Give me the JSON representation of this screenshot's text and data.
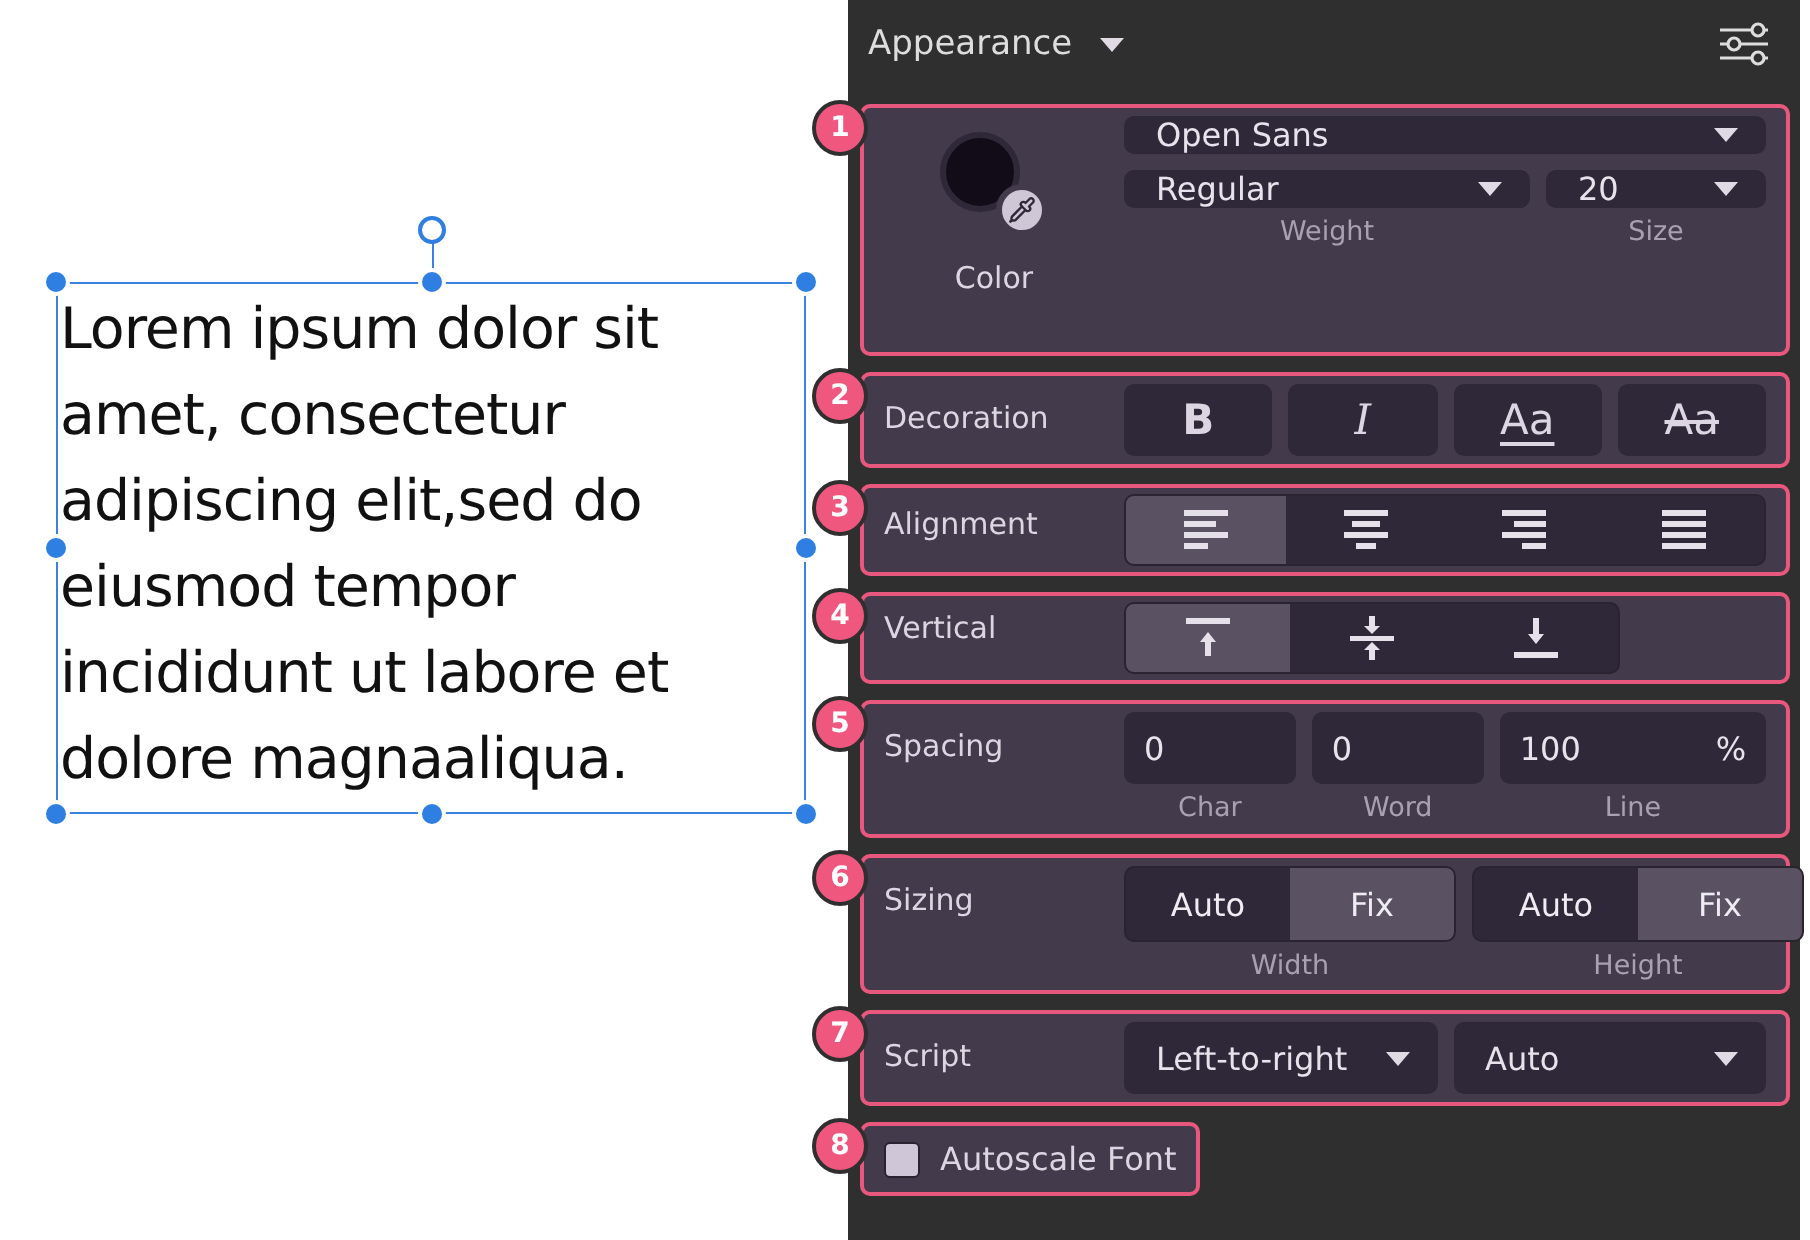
{
  "canvas": {
    "text_lines": [
      "Lorem ipsum dolor sit",
      "amet, consectetur",
      "adipiscing elit,sed do",
      "eiusmod tempor",
      "incididunt ut labore et",
      "dolore magnaaliqua."
    ]
  },
  "panel": {
    "title": "Appearance"
  },
  "sections": [
    {
      "kind": "font",
      "badge": "1",
      "color_label": "Color",
      "font": "Open Sans",
      "weight": "Regular",
      "size": "20",
      "weight_caption": "Weight",
      "size_caption": "Size"
    },
    {
      "kind": "decoration",
      "badge": "2",
      "label": "Decoration",
      "buttons": [
        {
          "kind": "bold",
          "text": "B"
        },
        {
          "kind": "italic",
          "text": "I"
        },
        {
          "kind": "underline",
          "text": "Aa"
        },
        {
          "kind": "strike",
          "text": "Aa"
        }
      ]
    },
    {
      "kind": "alignment",
      "badge": "3",
      "label": "Alignment",
      "options": [
        {
          "kind": "left",
          "selected": true
        },
        {
          "kind": "center",
          "selected": false
        },
        {
          "kind": "right",
          "selected": false
        },
        {
          "kind": "justify",
          "selected": false
        }
      ]
    },
    {
      "kind": "vertical",
      "badge": "4",
      "label": "Vertical",
      "options": [
        {
          "kind": "top",
          "selected": true
        },
        {
          "kind": "middle",
          "selected": false
        },
        {
          "kind": "bottom",
          "selected": false
        }
      ]
    },
    {
      "kind": "spacing",
      "badge": "5",
      "label": "Spacing",
      "fields": [
        {
          "value": "0",
          "caption": "Char"
        },
        {
          "value": "0",
          "caption": "Word"
        },
        {
          "value": "100",
          "unit": "%",
          "caption": "Line"
        }
      ]
    },
    {
      "kind": "sizing",
      "badge": "6",
      "label": "Sizing",
      "groups": [
        {
          "caption": "Width",
          "options": [
            {
              "text": "Auto",
              "selected": false
            },
            {
              "text": "Fix",
              "selected": true
            }
          ]
        },
        {
          "caption": "Height",
          "options": [
            {
              "text": "Auto",
              "selected": false
            },
            {
              "text": "Fix",
              "selected": true
            }
          ]
        }
      ]
    },
    {
      "kind": "script",
      "badge": "7",
      "label": "Script",
      "direction": "Left-to-right",
      "script": "Auto"
    },
    {
      "kind": "checkbox",
      "badge": "8",
      "label": "Autoscale Font",
      "checked": false
    }
  ]
}
